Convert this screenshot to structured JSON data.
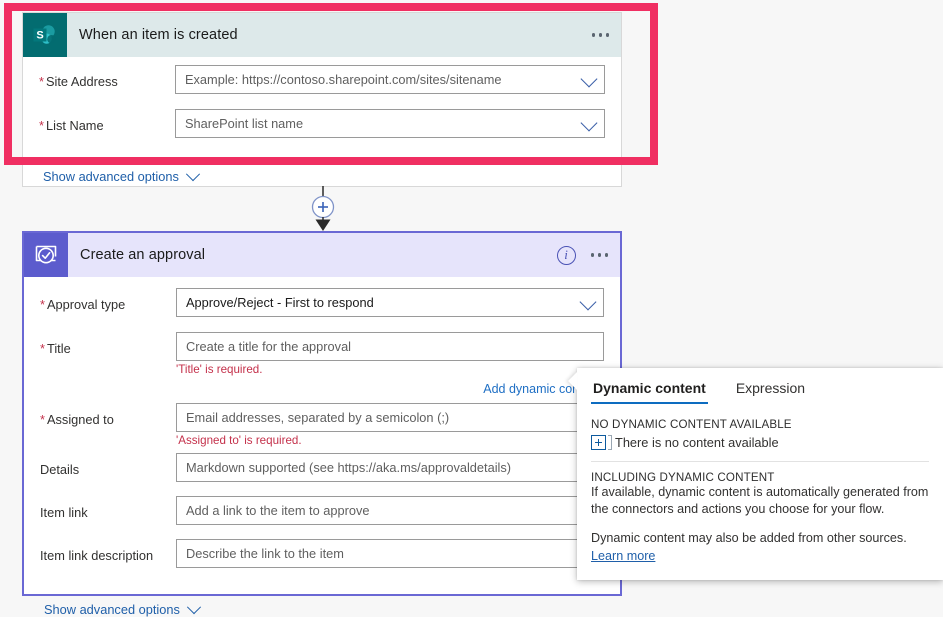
{
  "trigger_card": {
    "title": "When an item is created",
    "icon": "sharepoint-icon",
    "menu_icon": "ellipsis-icon",
    "fields": [
      {
        "label": "Site Address",
        "required": true,
        "placeholder": "Example: https://contoso.sharepoint.com/sites/sitename",
        "has_dropdown": true
      },
      {
        "label": "List Name",
        "required": true,
        "placeholder": "SharePoint list name",
        "has_dropdown": true
      }
    ],
    "advanced_label": "Show advanced options"
  },
  "connector": {
    "add_icon": "plus-circle-icon",
    "arrow_icon": "arrow-down-icon"
  },
  "approval_card": {
    "title": "Create an approval",
    "icon": "approval-icon",
    "info_icon": "info-icon",
    "menu_icon": "ellipsis-icon",
    "dynamic_link": "Add dynamic content",
    "fields": [
      {
        "label": "Approval type",
        "required": true,
        "value": "Approve/Reject - First to respond",
        "has_dropdown": true,
        "error": ""
      },
      {
        "label": "Title",
        "required": true,
        "placeholder": "Create a title for the approval",
        "has_dropdown": false,
        "error": "'Title' is required."
      },
      {
        "label": "Assigned to",
        "required": true,
        "placeholder": "Email addresses, separated by a semicolon (;)",
        "has_dropdown": false,
        "error": "'Assigned to' is required."
      },
      {
        "label": "Details",
        "required": false,
        "placeholder": "Markdown supported (see https://aka.ms/approvaldetails)",
        "has_dropdown": false,
        "error": ""
      },
      {
        "label": "Item link",
        "required": false,
        "placeholder": "Add a link to the item to approve",
        "has_dropdown": false,
        "error": ""
      },
      {
        "label": "Item link description",
        "required": false,
        "placeholder": "Describe the link to the item",
        "has_dropdown": false,
        "error": ""
      }
    ],
    "advanced_label": "Show advanced options"
  },
  "dynamic_panel": {
    "tabs": [
      {
        "label": "Dynamic content",
        "active": true
      },
      {
        "label": "Expression",
        "active": false
      }
    ],
    "no_content_heading": "NO DYNAMIC CONTENT AVAILABLE",
    "no_content_text": "There is no content available",
    "including_heading": "INCLUDING DYNAMIC CONTENT",
    "including_text": "If available, dynamic content is automatically generated from the connectors and actions you choose for your flow.",
    "other_sources_text": "Dynamic content may also be added from other sources.",
    "learn_more": "Learn more"
  },
  "colors": {
    "highlight": "#f02f62",
    "selected_card_border": "#6a68d4",
    "sharepoint_teal": "#036c70",
    "approval_purple": "#5c5ccd",
    "trigger_header": "#dde9ea",
    "approval_header": "#e6e4fb",
    "error_red": "#c4314b",
    "link_blue": "#1f6fc4",
    "tab_underline": "#0d6cc0"
  }
}
